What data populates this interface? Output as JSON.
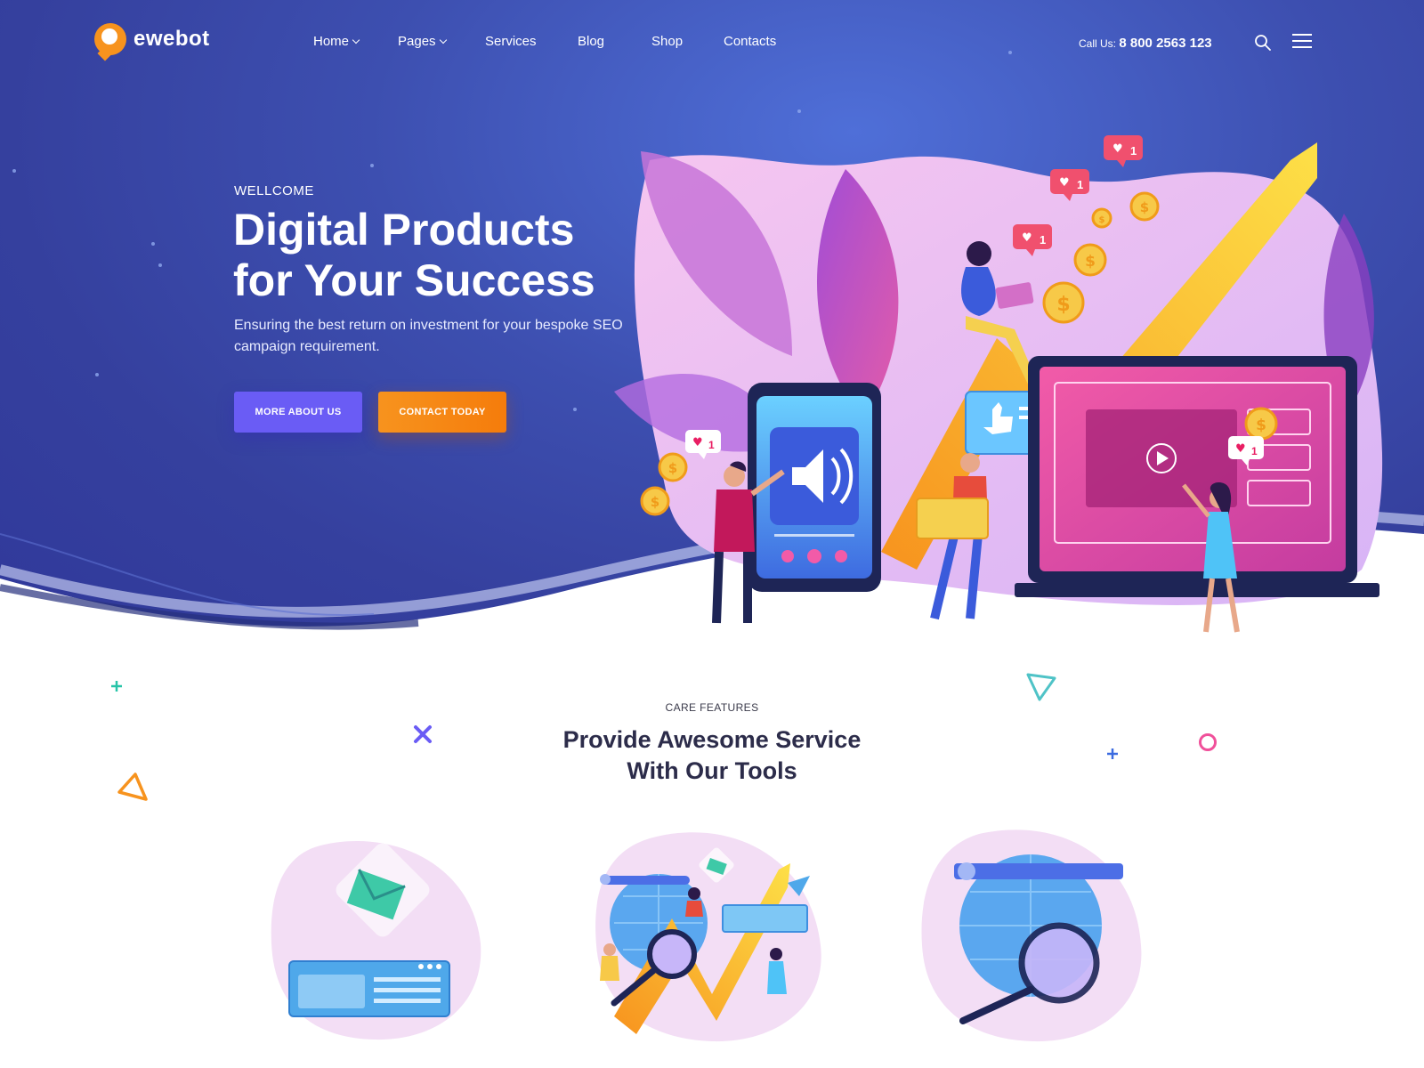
{
  "brand": {
    "name": "ewebot",
    "accent": "#f7931e",
    "primary": "#3d4fb0"
  },
  "nav": {
    "items": [
      {
        "label": "Home",
        "has_dropdown": true
      },
      {
        "label": "Pages",
        "has_dropdown": true
      },
      {
        "label": "Services",
        "has_dropdown": false
      },
      {
        "label": "Blog",
        "has_dropdown": false
      },
      {
        "label": "Shop",
        "has_dropdown": false
      },
      {
        "label": "Contacts",
        "has_dropdown": false
      }
    ],
    "call_label": "Call Us:",
    "call_number": "8 800 2563 123",
    "icons": [
      "search-icon",
      "hamburger-menu-icon"
    ]
  },
  "hero": {
    "eyebrow": "WELLCOME",
    "title_line1": "Digital Products",
    "title_line2": "for Your Success",
    "subtitle": "Ensuring the best return on investment for your bespoke SEO campaign requirement.",
    "primary_button": "MORE ABOUT US",
    "secondary_button": "CONTACT TODAY",
    "badges": [
      "1",
      "1",
      "1",
      "1",
      "1",
      "1"
    ]
  },
  "features": {
    "eyebrow": "CARE FEATURES",
    "title_line1": "Provide Awesome Service",
    "title_line2": "With Our Tools"
  }
}
